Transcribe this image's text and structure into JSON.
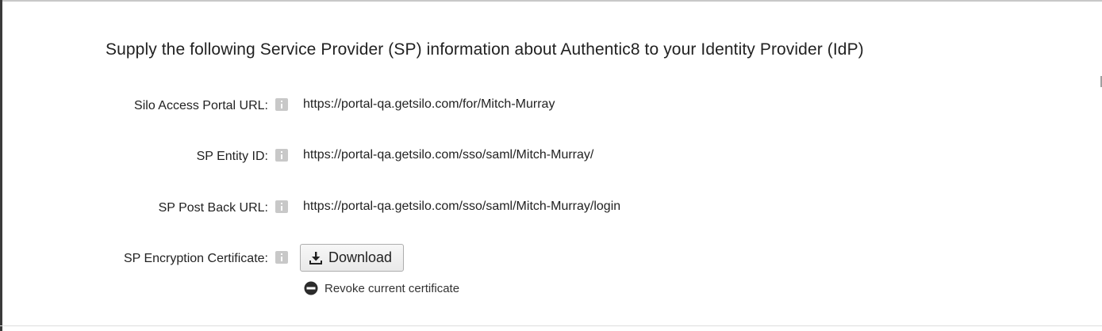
{
  "section": {
    "heading": "Supply the following Service Provider (SP) information about Authentic8 to your Identity Provider (IdP)"
  },
  "fields": [
    {
      "label": "Silo Access Portal URL:",
      "info_icon": "info-icon",
      "value": "https://portal-qa.getsilo.com/for/Mitch-Murray"
    },
    {
      "label": "SP Entity ID:",
      "info_icon": "info-icon",
      "value": "https://portal-qa.getsilo.com/sso/saml/Mitch-Murray/"
    },
    {
      "label": "SP Post Back URL:",
      "info_icon": "info-icon",
      "value": "https://portal-qa.getsilo.com/sso/saml/Mitch-Murray/login"
    },
    {
      "label": "SP Encryption Certificate:",
      "info_icon": "info-icon"
    }
  ],
  "certificate": {
    "download_label": "Download",
    "download_icon": "download-icon",
    "revoke_label": "Revoke current certificate",
    "revoke_icon": "minus-circle-icon"
  },
  "colors": {
    "text": "#222222",
    "info_icon_bg": "#c8c8c8",
    "button_border": "#adadad"
  }
}
